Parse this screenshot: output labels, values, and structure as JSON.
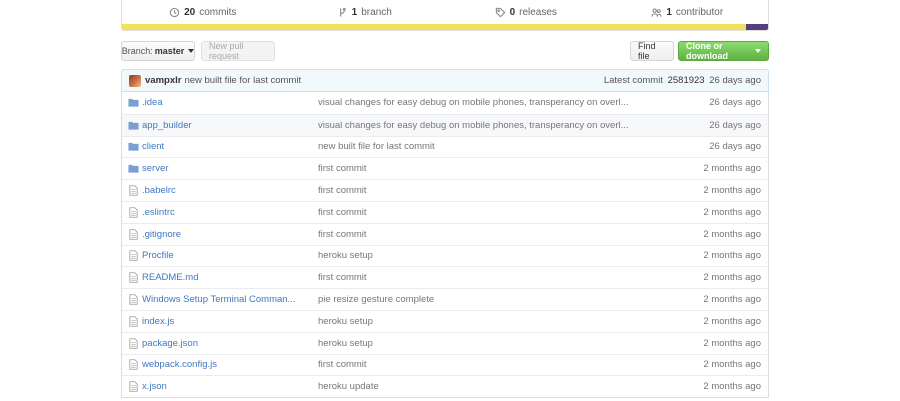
{
  "stats": {
    "commits": {
      "count": "20",
      "label": "commits"
    },
    "branches": {
      "count": "1",
      "label": "branch"
    },
    "releases": {
      "count": "0",
      "label": "releases"
    },
    "contributors": {
      "count": "1",
      "label": "contributor"
    }
  },
  "toolbar": {
    "branch_label": "Branch:",
    "branch_value": "master",
    "new_pr": "New pull request",
    "find_file": "Find file",
    "clone": "Clone or download"
  },
  "commit": {
    "author": "vampxlr",
    "message": "new built file for last commit",
    "latest_label": "Latest commit",
    "sha": "2581923",
    "age": "26 days ago"
  },
  "files": [
    {
      "type": "folder",
      "name": ".idea",
      "message": "visual changes for easy debug on mobile phones, transperancy on overl...",
      "age": "26 days ago"
    },
    {
      "type": "folder",
      "name": "app_builder",
      "message": "visual changes for easy debug on mobile phones, transperancy on overl...",
      "age": "26 days ago"
    },
    {
      "type": "folder",
      "name": "client",
      "message": "new built file for last commit",
      "age": "26 days ago"
    },
    {
      "type": "folder",
      "name": "server",
      "message": "first commit",
      "age": "2 months ago"
    },
    {
      "type": "file",
      "name": ".babelrc",
      "message": "first commit",
      "age": "2 months ago"
    },
    {
      "type": "file",
      "name": ".eslintrc",
      "message": "first commit",
      "age": "2 months ago"
    },
    {
      "type": "file",
      "name": ".gitignore",
      "message": "first commit",
      "age": "2 months ago"
    },
    {
      "type": "file",
      "name": "Procfile",
      "message": "heroku setup",
      "age": "2 months ago"
    },
    {
      "type": "file",
      "name": "README.md",
      "message": "first commit",
      "age": "2 months ago"
    },
    {
      "type": "file",
      "name": "Windows Setup Terminal Comman...",
      "message": "pie resize gesture complete",
      "age": "2 months ago"
    },
    {
      "type": "file",
      "name": "index.js",
      "message": "heroku setup",
      "age": "2 months ago"
    },
    {
      "type": "file",
      "name": "package.json",
      "message": "heroku setup",
      "age": "2 months ago"
    },
    {
      "type": "file",
      "name": "webpack.config.js",
      "message": "first commit",
      "age": "2 months ago"
    },
    {
      "type": "file",
      "name": "x.json",
      "message": "heroku update",
      "age": "2 months ago"
    }
  ],
  "icons": {
    "folder": "folder-icon",
    "file": "file-icon",
    "commits": "history-icon",
    "branch": "branch-icon",
    "releases": "tag-icon",
    "contributors": "people-icon"
  },
  "colors": {
    "link": "#4078c0",
    "clone_green": "#60b044",
    "lang_js": "#f1e05a",
    "lang_other": "#563d7c",
    "folder": "#7a9fd3"
  }
}
